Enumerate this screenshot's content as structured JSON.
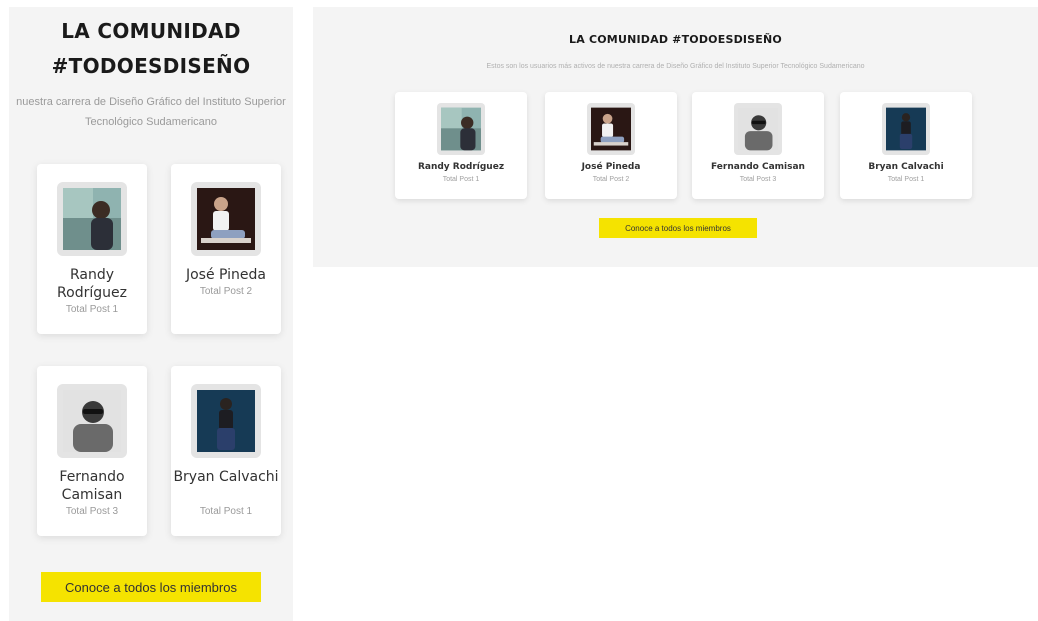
{
  "mobile": {
    "title_line1": "LA COMUNIDAD",
    "title_line2": "#TODOESDISEÑO",
    "subtitle": "nuestra carrera de Diseño Gráfico del Instituto Superior Tecnológico Sudamericano",
    "button_label": "Conoce a todos los miembros",
    "members": [
      {
        "name": "Randy Rodríguez",
        "posts": "Total Post 1",
        "photo": "portrait-photo"
      },
      {
        "name": "José Pineda",
        "posts": "Total Post 2",
        "photo": "portrait-photo"
      },
      {
        "name": "Fernando Camisan",
        "posts": "Total Post 3",
        "photo": "portrait-photo"
      },
      {
        "name": "Bryan Calvachi",
        "posts": "Total Post 1",
        "photo": "portrait-photo"
      }
    ]
  },
  "desktop": {
    "title": "LA COMUNIDAD  #TODOESDISEÑO",
    "subtitle": "Estos son los usuarios más activos de nuestra carrera de Diseño Gráfico del Instituto Superior Tecnológico Sudamericano",
    "button_label": "Conoce a todos los miembros",
    "members": [
      {
        "name": "Randy Rodríguez",
        "posts": "Total Post 1"
      },
      {
        "name": "José Pineda",
        "posts": "Total Post 2"
      },
      {
        "name": "Fernando Camisan",
        "posts": "Total Post 3"
      },
      {
        "name": "Bryan Calvachi",
        "posts": "Total Post 1"
      }
    ]
  },
  "colors": {
    "accent_yellow": "#f5e300",
    "panel_bg": "#f4f4f4",
    "card_bg": "#ffffff"
  }
}
